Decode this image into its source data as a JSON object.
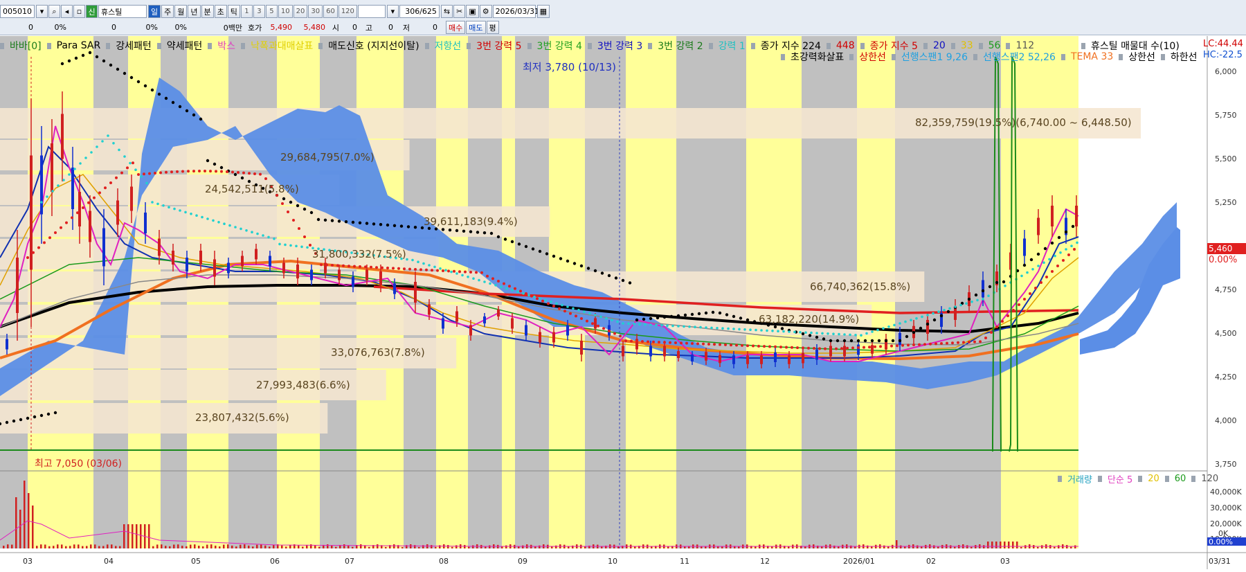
{
  "toolbar": {
    "code": "005010",
    "name_badge": "신",
    "name": "휴스틸",
    "periods": [
      "일",
      "주",
      "월",
      "년",
      "분",
      "초",
      "틱"
    ],
    "minutes": [
      "1",
      "3",
      "5",
      "10",
      "20",
      "30",
      "60",
      "120"
    ],
    "count": "306/625",
    "date": "2026/03/31",
    "row2": {
      "v1": "0",
      "v2": "0%",
      "v3": "0",
      "v4": "0%",
      "v5": "0%",
      "unit": "0백만",
      "hoga_label": "호가",
      "ask": "5,490",
      "bid": "5,480",
      "si_label": "시",
      "si": "0",
      "go_label": "고",
      "go": "0",
      "jeo_label": "저",
      "jeo": "0",
      "buy": "매수",
      "sell": "매도",
      "avg": "평"
    }
  },
  "legend1": [
    {
      "text": "바바[0]",
      "color": "#1a7a1a"
    },
    {
      "text": "Para SAR",
      "color": "#000000"
    },
    {
      "text": "강세패턴",
      "color": "#000000"
    },
    {
      "text": "약세패턴",
      "color": "#000000"
    },
    {
      "text": "박스",
      "color": "#e040c0"
    },
    {
      "text": "낙폭과대매살표",
      "color": "#e0d000"
    },
    {
      "text": "매도신호 (지지선이탈)",
      "color": "#000000"
    },
    {
      "text": "저항선",
      "color": "#20c0c0"
    },
    {
      "text": "3번 강력 5",
      "color": "#d00000"
    },
    {
      "text": "3번 강력 4",
      "color": "#20a020"
    },
    {
      "text": "3번 강력 3",
      "color": "#1010c0"
    },
    {
      "text": "3번 강력 2",
      "color": "#1a7a1a"
    },
    {
      "text": "강력 1",
      "color": "#20c0c0"
    },
    {
      "text": "종가 지수 224",
      "color": "#000000"
    },
    {
      "text": "448",
      "color": "#d00000"
    },
    {
      "text": "종가 지수 5",
      "color": "#d00000"
    },
    {
      "text": "20",
      "color": "#1010c0"
    },
    {
      "text": "33",
      "color": "#e0c000"
    },
    {
      "text": "56",
      "color": "#1a9a1a"
    },
    {
      "text": "112",
      "color": "#555555"
    }
  ],
  "legend_right_title": "휴스틸 매물대 수(10)",
  "legend2": [
    {
      "text": "초강력화살표",
      "color": "#000000"
    },
    {
      "text": "상한선",
      "color": "#d00000"
    },
    {
      "text": "선행스팬1 9,26",
      "color": "#20a0e0"
    },
    {
      "text": "선행스팬2 52,26",
      "color": "#20a0e0"
    },
    {
      "text": "TEMA 33",
      "color": "#f07020"
    },
    {
      "text": "상한선",
      "color": "#000000"
    },
    {
      "text": "하한선",
      "color": "#000000"
    }
  ],
  "right_labels": {
    "lc": "LC:44.44",
    "hc": "HC:-22.5"
  },
  "price_ticks": [
    "6,000",
    "5,750",
    "5,500",
    "5,250",
    "5,000",
    "4,750",
    "4,500",
    "4,250",
    "4,000",
    "3,750"
  ],
  "current_price": {
    "price": "5,460",
    "change": "0.00%"
  },
  "volume_legend": [
    {
      "text": "거래량",
      "color": "#20a0c0"
    },
    {
      "text": "단순 5",
      "color": "#e040c0"
    },
    {
      "text": "20",
      "color": "#e0c000"
    },
    {
      "text": "60",
      "color": "#1a9a1a"
    },
    {
      "text": "120",
      "color": "#555555"
    }
  ],
  "volume_ticks": [
    "40,000K",
    "30,000K",
    "20,000K",
    "10,000K",
    "0K"
  ],
  "volume_current": "0.00%",
  "x_ticks": [
    "03",
    "04",
    "05",
    "06",
    "07",
    "08",
    "09",
    "10",
    "11",
    "12",
    "2026/01",
    "02",
    "03",
    "03/31"
  ],
  "annotations": {
    "low": "최저 3,780 (10/13)",
    "high": "최고 7,050 (03/06)"
  },
  "volume_profile": [
    {
      "label": "82,359,759(19.5%)(6,740.00 ~ 6,448.50)",
      "pct": 19.5
    },
    {
      "label": "29,684,795(7.0%)",
      "pct": 7.0
    },
    {
      "label": "24,542,511(5.8%)",
      "pct": 5.8
    },
    {
      "label": "39,611,183(9.4%)",
      "pct": 9.4
    },
    {
      "label": "31,800,332(7.5%)",
      "pct": 7.5
    },
    {
      "label": "66,740,362(15.8%)",
      "pct": 15.8
    },
    {
      "label": "63,182,220(14.9%)",
      "pct": 14.9
    },
    {
      "label": "33,076,763(7.8%)",
      "pct": 7.8
    },
    {
      "label": "27,993,483(6.6%)",
      "pct": 6.6
    },
    {
      "label": "23,807,432(5.6%)",
      "pct": 5.6
    }
  ],
  "colors": {
    "yellow_band": "#ffff99",
    "gray_band": "#c0c0c0",
    "cloud": "#5b8ee6",
    "profile_bar": "#f5e6d0"
  }
}
